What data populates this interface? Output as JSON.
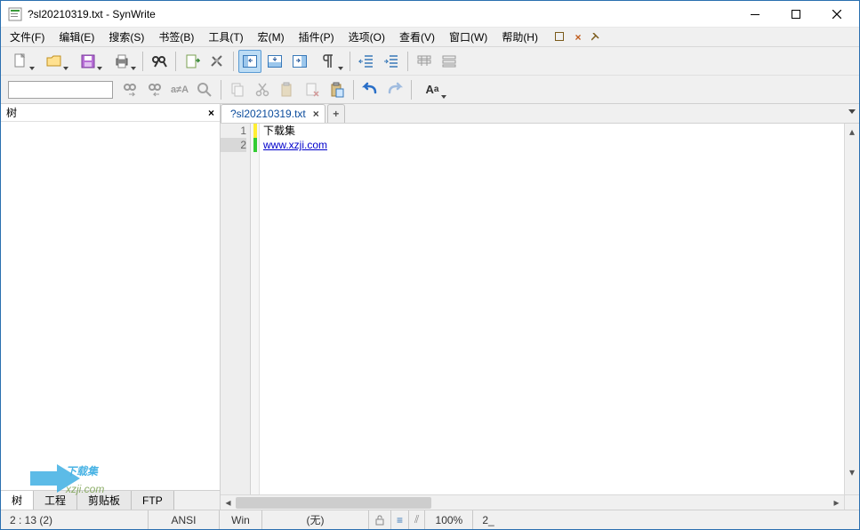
{
  "window": {
    "title": "?sl20210319.txt - SynWrite"
  },
  "menu": {
    "items": [
      "文件(F)",
      "编辑(E)",
      "搜索(S)",
      "书签(B)",
      "工具(T)",
      "宏(M)",
      "插件(P)",
      "选项(O)",
      "查看(V)",
      "窗口(W)",
      "帮助(H)"
    ]
  },
  "toolbar1": {
    "buttons": [
      "new",
      "open",
      "save",
      "print",
      "sep",
      "find",
      "sep",
      "goto",
      "settings",
      "sep",
      "panel-left",
      "panel-bottom",
      "panel-right",
      "pilcrow",
      "sep",
      "unindent",
      "indent",
      "sep",
      "wrap1",
      "wrap2"
    ]
  },
  "toolbar2": {
    "search_placeholder": "",
    "buttons": [
      "find-next",
      "find-prev",
      "match-case",
      "zoom",
      "sep",
      "copy",
      "cut",
      "paste",
      "delete",
      "paste2",
      "sep",
      "undo",
      "redo",
      "sep",
      "font"
    ]
  },
  "sidepanel": {
    "title": "树",
    "tabs": [
      "树",
      "工程",
      "剪贴板",
      "FTP"
    ],
    "active_tab": 0
  },
  "tabs": {
    "items": [
      {
        "name": "?sl20210319.txt"
      }
    ]
  },
  "editor": {
    "lines": [
      {
        "n": 1,
        "mark": "y",
        "text": "下载集"
      },
      {
        "n": 2,
        "mark": "g",
        "link": "www.xzji.com"
      }
    ],
    "active_line": 2
  },
  "status": {
    "pos": "2 : 13 (2)",
    "encoding": "ANSI",
    "eol": "Win",
    "lexer": "(无)",
    "lock": "🔓",
    "icon1": "≡",
    "icon2": "⫽",
    "zoom": "100%",
    "extra": "2_"
  },
  "watermark": {
    "text1": "下载集",
    "text2": "xzji.com"
  }
}
